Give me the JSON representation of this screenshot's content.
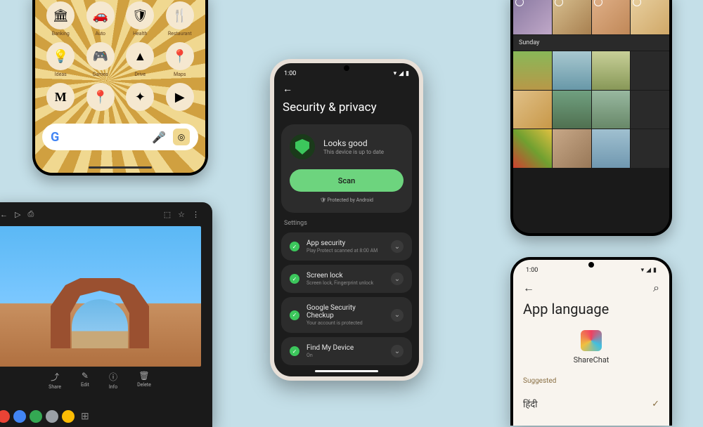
{
  "phone1": {
    "apps": [
      {
        "icon": "🏛",
        "label": "Banking"
      },
      {
        "icon": "🚗",
        "label": "Auto"
      },
      {
        "icon": "🛡",
        "label": "Health"
      },
      {
        "icon": "🍴",
        "label": "Restaurant"
      },
      {
        "icon": "💡",
        "label": "Ideas"
      },
      {
        "icon": "🎮",
        "label": "Games"
      },
      {
        "icon": "▲",
        "label": "Drive"
      },
      {
        "icon": "📍",
        "label": "Maps"
      },
      {
        "icon": "M",
        "label": ""
      },
      {
        "icon": "📍",
        "label": ""
      },
      {
        "icon": "✦",
        "label": ""
      },
      {
        "icon": "▶",
        "label": ""
      }
    ],
    "search_logo": "G"
  },
  "security": {
    "time": "1:00",
    "title": "Security & privacy",
    "status_title": "Looks good",
    "status_sub": "This device is up to date",
    "scan_label": "Scan",
    "protected_label": "🛡 Protected by Android",
    "settings_label": "Settings",
    "items": [
      {
        "title": "App security",
        "sub": "Play Protect scanned at 8:00 AM"
      },
      {
        "title": "Screen lock",
        "sub": "Screen lock, Fingerprint unlock"
      },
      {
        "title": "Google Security Checkup",
        "sub": "Your account is protected"
      },
      {
        "title": "Find My Device",
        "sub": "On"
      }
    ]
  },
  "photos": {
    "day_label": "Sunday",
    "row1": [
      "linear-gradient(135deg,#8878a0,#c0a8c8)",
      "linear-gradient(135deg,#d8c090,#a88050)",
      "linear-gradient(135deg,#e0b088,#c08858)",
      "linear-gradient(135deg,#e8d0a0,#d0a868)"
    ],
    "row2": [
      "linear-gradient(180deg,#88b858,#b89848)",
      "linear-gradient(180deg,#a8c8d0,#6898a8)",
      "linear-gradient(180deg,#c8d098,#889858)",
      "#2a2a2a",
      "linear-gradient(135deg,#e0c088,#c89848)",
      "linear-gradient(180deg,#70a080,#507050)",
      "linear-gradient(180deg,#98b8a0,#688868)",
      "#2a2a2a",
      "linear-gradient(45deg,#d04030,#70a030,#e0c040)",
      "linear-gradient(135deg,#c8a888,#987858)",
      "linear-gradient(180deg,#a0c0d0,#7098b0)",
      "#2a2a2a"
    ]
  },
  "tablet": {
    "tools": [
      {
        "icon": "⤴",
        "label": "Share"
      },
      {
        "icon": "✎",
        "label": "Edit"
      },
      {
        "icon": "ⓘ",
        "label": "Info"
      },
      {
        "icon": "🗑",
        "label": "Delete"
      }
    ],
    "taskbar_colors": [
      "#ea4335",
      "#4285f4",
      "#34a853",
      "#9aa0a6",
      "#fbbc04",
      "#5f6368"
    ]
  },
  "app_language": {
    "time": "1:00",
    "title": "App language",
    "app_name": "ShareChat",
    "suggested_label": "Suggested",
    "languages": [
      {
        "name": "हिंदी",
        "selected": true
      }
    ]
  }
}
